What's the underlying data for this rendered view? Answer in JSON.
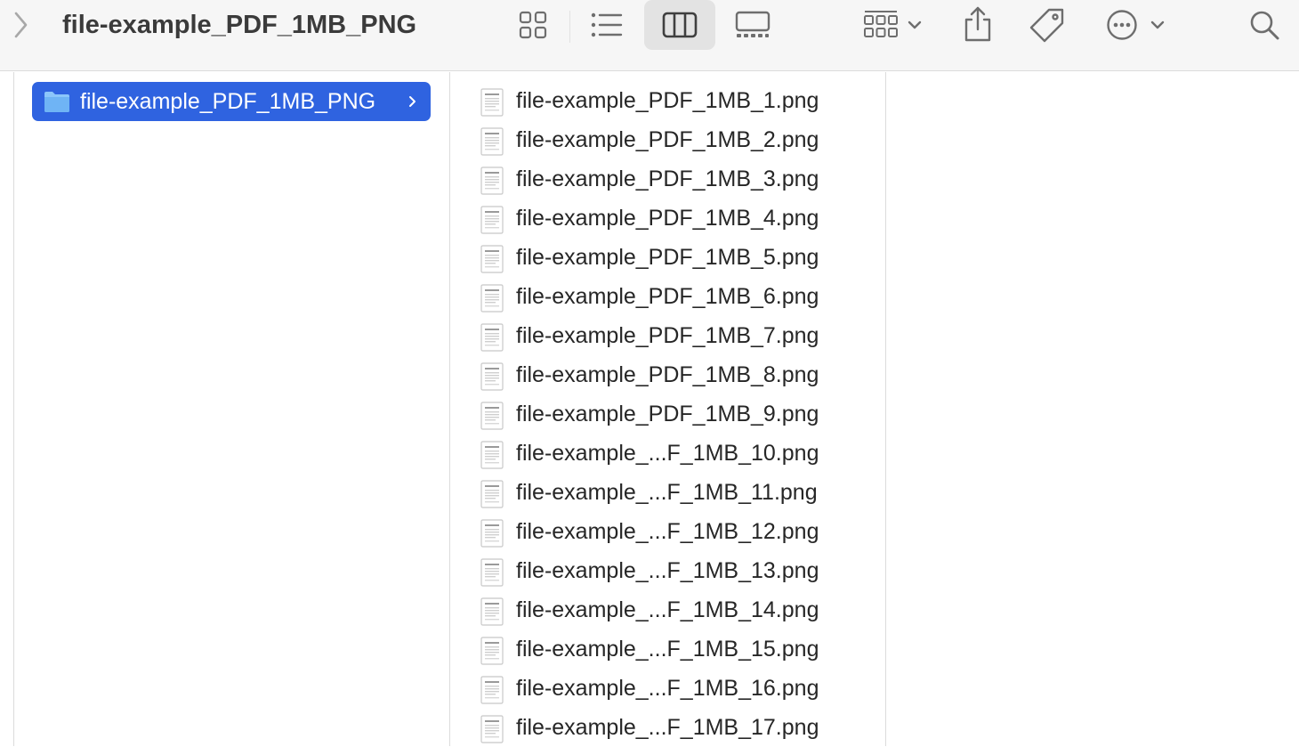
{
  "window": {
    "title": "file-example_PDF_1MB_PNG"
  },
  "toolbar": {
    "back_icon": "chevron-left-icon",
    "views": [
      {
        "name": "icons",
        "icon": "grid-icon",
        "active": false
      },
      {
        "name": "list",
        "icon": "list-icon",
        "active": false
      },
      {
        "name": "columns",
        "icon": "columns-icon",
        "active": true
      },
      {
        "name": "gallery",
        "icon": "gallery-icon",
        "active": false
      }
    ],
    "group_icon": "group-grid-icon",
    "share_icon": "share-icon",
    "tag_icon": "tag-icon",
    "more_icon": "ellipsis-circle-icon",
    "search_icon": "search-icon"
  },
  "columns": {
    "first": {
      "selected_folder": "file-example_PDF_1MB_PNG",
      "folder_icon": "folder-icon"
    },
    "second": {
      "files": [
        "file-example_PDF_1MB_1.png",
        "file-example_PDF_1MB_2.png",
        "file-example_PDF_1MB_3.png",
        "file-example_PDF_1MB_4.png",
        "file-example_PDF_1MB_5.png",
        "file-example_PDF_1MB_6.png",
        "file-example_PDF_1MB_7.png",
        "file-example_PDF_1MB_8.png",
        "file-example_PDF_1MB_9.png",
        "file-example_...F_1MB_10.png",
        "file-example_...F_1MB_11.png",
        "file-example_...F_1MB_12.png",
        "file-example_...F_1MB_13.png",
        "file-example_...F_1MB_14.png",
        "file-example_...F_1MB_15.png",
        "file-example_...F_1MB_16.png",
        "file-example_...F_1MB_17.png"
      ]
    }
  },
  "colors": {
    "selection": "#2f63e0",
    "toolbar_bg": "#f6f6f6",
    "icon_gray": "#6e6e6e",
    "folder_blue": "#7fbdf7"
  }
}
